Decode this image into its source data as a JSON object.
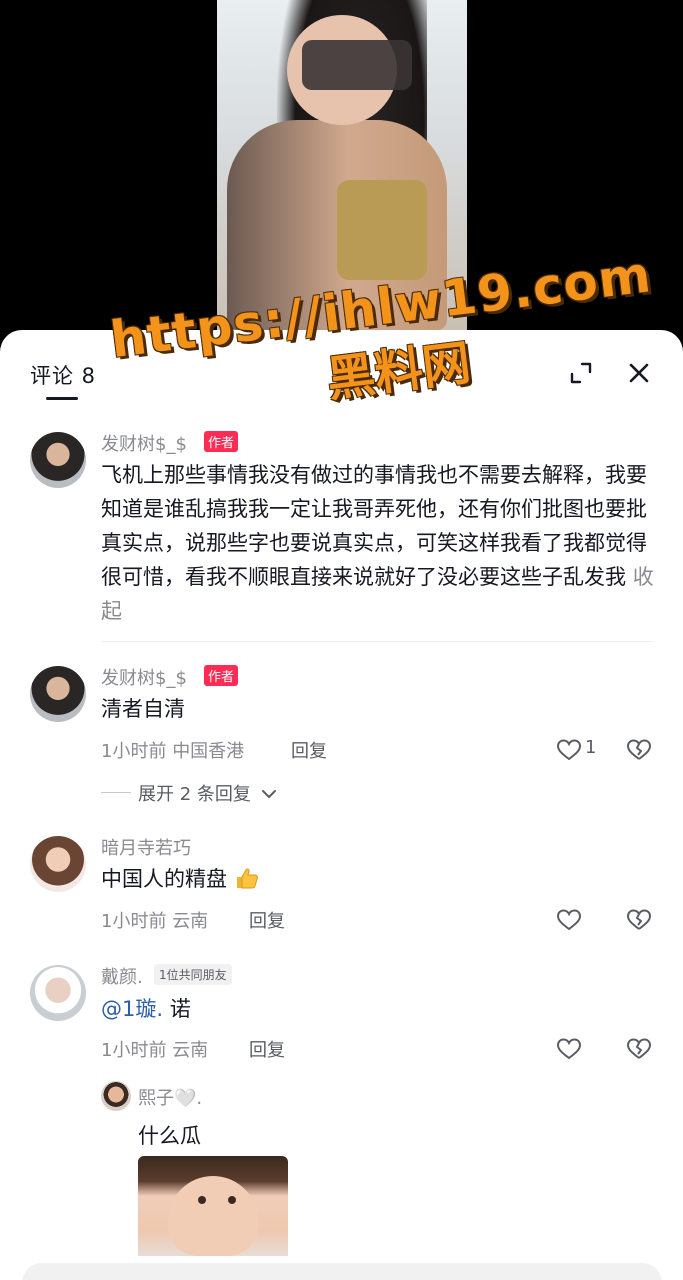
{
  "header": {
    "title": "评论 8"
  },
  "watermark": {
    "url": "https://ihlw19.com",
    "label": "黑料网"
  },
  "comments": [
    {
      "username": "发财树$_$",
      "badge": "作者",
      "text": "飞机上那些事情我没有做过的事情我也不需要去解释，我要知道是谁乱搞我我一定让我哥弄死他，还有你们批图也要批真实点，说那些字也要说真实点，可笑这样我看了我都觉得很可惜，看我不顺眼直接来说就好了没必要这些子乱发我",
      "collapse_label": "收起"
    },
    {
      "username": "发财树$_$",
      "badge": "作者",
      "text": "清者自清",
      "time": "1小时前",
      "location": "中国香港",
      "reply_label": "回复",
      "like_count": "1",
      "expand_label": "展开 2 条回复"
    },
    {
      "username": "暗月寺若巧",
      "text": "中国人的精盘",
      "time": "1小时前",
      "location": "云南",
      "reply_label": "回复"
    },
    {
      "username": "戴颜.",
      "friend_badge": "1位共同朋友",
      "mention": "@1璇.",
      "text_after": " 诺",
      "time": "1小时前",
      "location": "云南",
      "reply_label": "回复",
      "sub_reply": {
        "username": "熙子🤍.",
        "text": "什么瓜"
      }
    }
  ],
  "icons": {
    "expand": "expand-icon",
    "close": "close-icon",
    "like": "heart-icon",
    "dislike": "broken-heart-icon",
    "thumb": "thumbs-up-emoji"
  },
  "colors": {
    "accent": "#fe2c55",
    "text": "#161823",
    "muted": "#8a8b91",
    "mention": "#2a5ea8"
  }
}
